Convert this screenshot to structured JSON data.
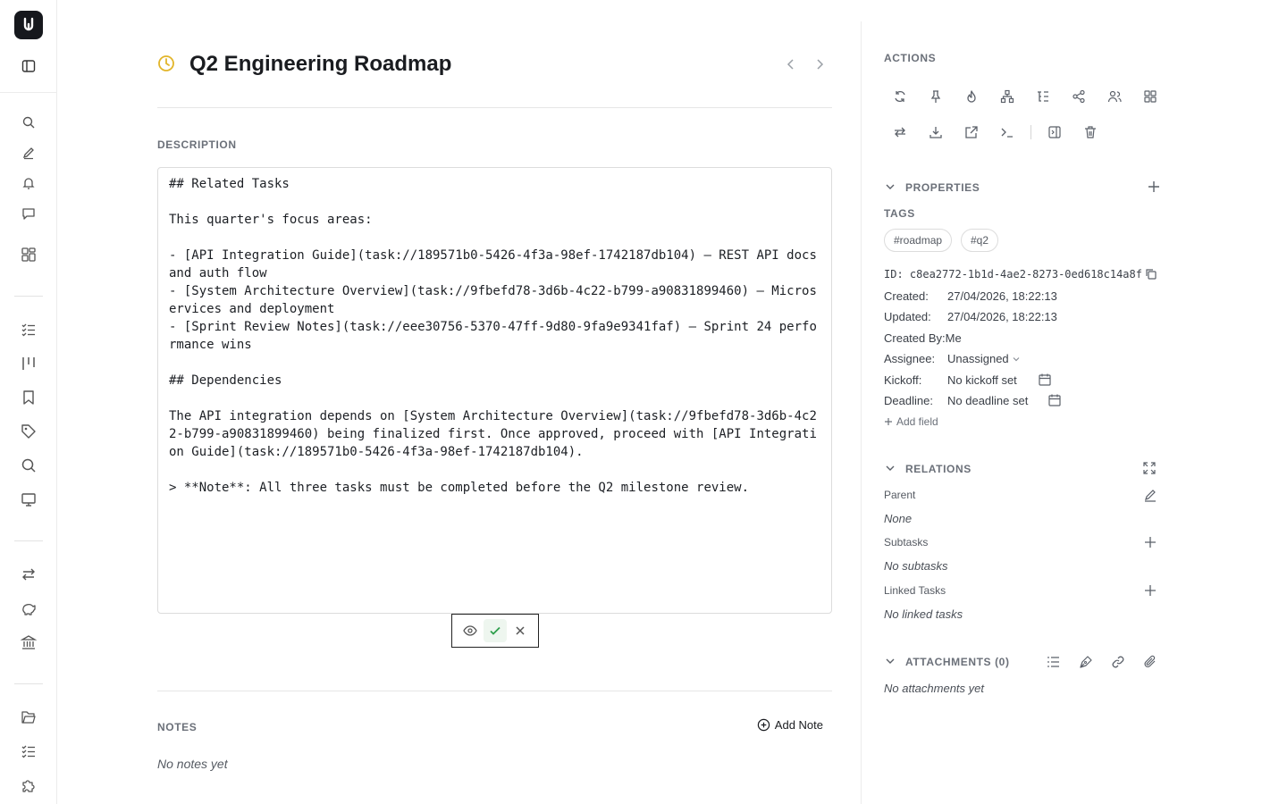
{
  "title": "Q2 Engineering Roadmap",
  "description": {
    "label": "DESCRIPTION",
    "content": "## Related Tasks\n\nThis quarter's focus areas:\n\n- [API Integration Guide](task://189571b0-5426-4f3a-98ef-1742187db104) — REST API docs and auth flow\n- [System Architecture Overview](task://9fbefd78-3d6b-4c22-b799-a90831899460) — Microservices and deployment\n- [Sprint Review Notes](task://eee30756-5370-47ff-9d80-9fa9e9341faf) — Sprint 24 performance wins\n\n## Dependencies\n\nThe API integration depends on [System Architecture Overview](task://9fbefd78-3d6b-4c22-b799-a90831899460) being finalized first. Once approved, proceed with [API Integration Guide](task://189571b0-5426-4f3a-98ef-1742187db104).\n\n> **Note**: All three tasks must be completed before the Q2 milestone review."
  },
  "notes": {
    "label": "NOTES",
    "add_label": "Add Note",
    "empty": "No notes yet"
  },
  "panel": {
    "actions_label": "ACTIONS",
    "properties_label": "PROPERTIES",
    "tags_label": "TAGS",
    "tags": [
      "#roadmap",
      "#q2"
    ],
    "id_text": "ID: c8ea2772-1b1d-4ae2-8273-0ed618c14a8f",
    "created_label": "Created:",
    "created_value": "27/04/2026, 18:22:13",
    "updated_label": "Updated:",
    "updated_value": "27/04/2026, 18:22:13",
    "created_by_label": "Created By:",
    "created_by_value": "Me",
    "assignee_label": "Assignee:",
    "assignee_value": "Unassigned",
    "kickoff_label": "Kickoff:",
    "kickoff_value": "No kickoff set",
    "deadline_label": "Deadline:",
    "deadline_value": "No deadline set",
    "add_field_label": "Add field",
    "relations_label": "RELATIONS",
    "parent_label": "Parent",
    "parent_value": "None",
    "subtasks_label": "Subtasks",
    "subtasks_value": "No subtasks",
    "linked_label": "Linked Tasks",
    "linked_value": "No linked tasks",
    "attachments_label": "ATTACHMENTS (0)",
    "attachments_value": "No attachments yet"
  },
  "colors": {
    "accent_clock": "#e2b52a",
    "confirm_green": "#2e9f4c"
  }
}
